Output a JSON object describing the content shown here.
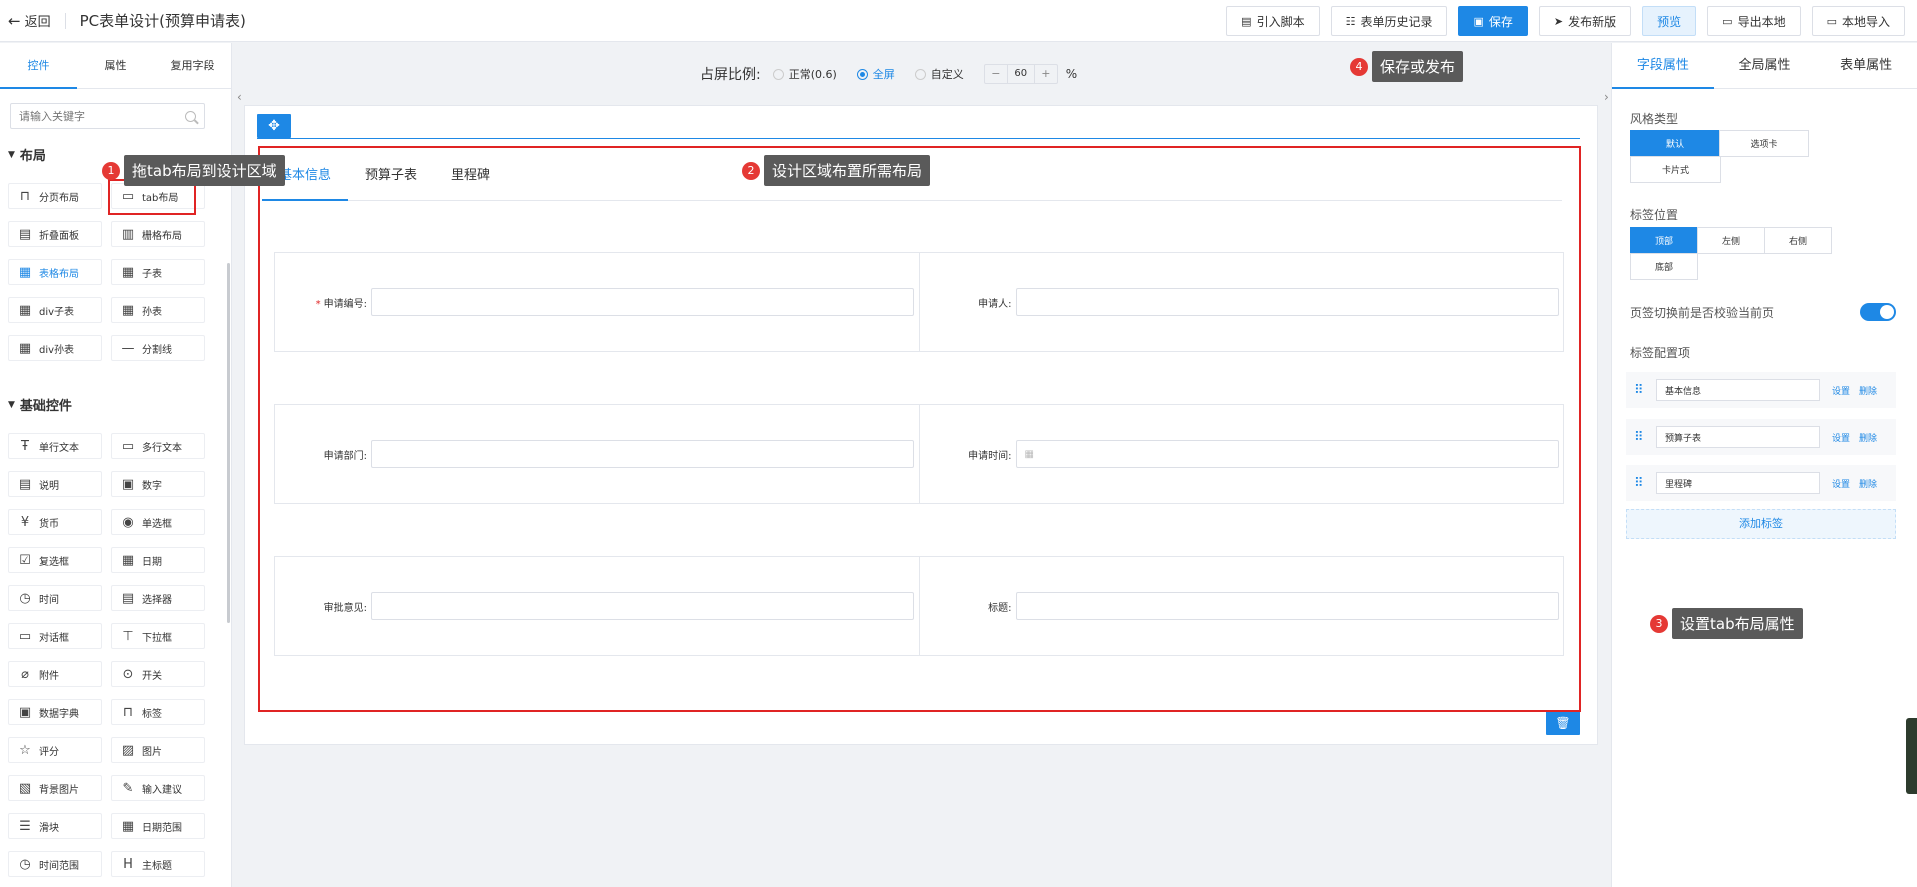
{
  "header": {
    "back_label": "返回",
    "title": "PC表单设计(预算申请表)",
    "buttons": {
      "import_script": "引入脚本",
      "history": "表单历史记录",
      "save": "保存",
      "publish": "发布新版",
      "preview": "预览",
      "export_local": "导出本地",
      "import_local": "本地导入"
    }
  },
  "left_panel": {
    "tabs": [
      "控件",
      "属性",
      "复用字段"
    ],
    "search_placeholder": "请输入关键字",
    "layout_section": "布局",
    "layout_items": [
      "分页布局",
      "tab布局",
      "折叠面板",
      "栅格布局",
      "表格布局",
      "子表",
      "div子表",
      "孙表",
      "div孙表",
      "分割线"
    ],
    "basic_section": "基础控件",
    "basic_items": [
      "单行文本",
      "多行文本",
      "说明",
      "数字",
      "货币",
      "单选框",
      "复选框",
      "日期",
      "时间",
      "选择器",
      "对话框",
      "下拉框",
      "附件",
      "开关",
      "数据字典",
      "标签",
      "评分",
      "图片",
      "背景图片",
      "输入建议",
      "滑块",
      "日期范围",
      "时间范围",
      "主标题"
    ]
  },
  "canvas": {
    "ratio_label": "占屏比例:",
    "ratio_options": [
      "正常(0.6)",
      "全屏",
      "自定义"
    ],
    "ratio_selected": "全屏",
    "zoom_minus": "−",
    "zoom_value": "60",
    "zoom_plus": "+",
    "zoom_unit": "%",
    "tabs": [
      "基本信息",
      "预算子表",
      "里程碑"
    ],
    "rows": [
      [
        {
          "label": "申请编号:",
          "required": true,
          "value": ""
        },
        {
          "label": "申请人:",
          "required": false,
          "value": ""
        }
      ],
      [
        {
          "label": "申请部门:",
          "required": false,
          "value": ""
        },
        {
          "label": "申请时间:",
          "required": false,
          "value": ""
        }
      ],
      [
        {
          "label": "审批意见:",
          "required": false,
          "value": ""
        },
        {
          "label": "标题:",
          "required": false,
          "value": ""
        }
      ]
    ]
  },
  "callouts": [
    {
      "num": "1",
      "text": "拖tab布局到设计区域"
    },
    {
      "num": "2",
      "text": "设计区域布置所需布局"
    },
    {
      "num": "3",
      "text": "设置tab布局属性"
    },
    {
      "num": "4",
      "text": "保存或发布"
    }
  ],
  "right_panel": {
    "tabs": [
      "字段属性",
      "全局属性",
      "表单属性"
    ],
    "style_type_label": "风格类型",
    "style_options": [
      "默认",
      "选项卡",
      "卡片式"
    ],
    "style_selected": "默认",
    "tag_position_label": "标签位置",
    "tag_positions": [
      "顶部",
      "左侧",
      "右侧",
      "底部"
    ],
    "tag_position_selected": "顶部",
    "validate_label": "页签切换前是否校验当前页",
    "validate_on": true,
    "tag_config_label": "标签配置项",
    "tag_items": [
      "基本信息",
      "预算子表",
      "里程碑"
    ],
    "set_label": "设置",
    "delete_label": "删除",
    "add_tag": "添加标签"
  },
  "colors": {
    "accent": "#1e88e5",
    "highlight": "#e02424",
    "callout_bg": "#5a5a5a"
  }
}
